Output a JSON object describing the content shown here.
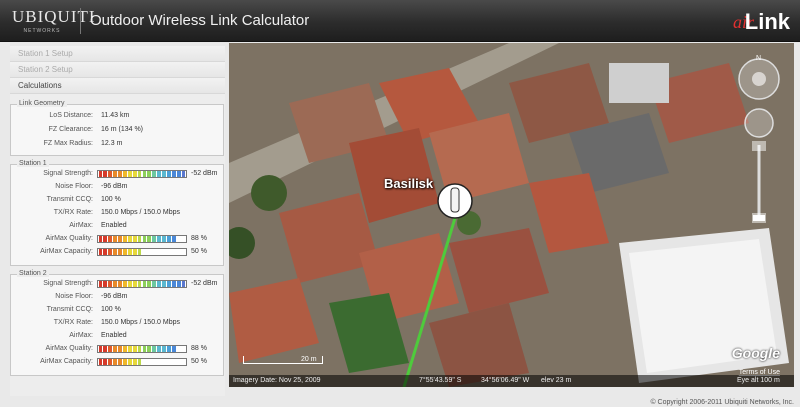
{
  "header": {
    "logo_text": "UBIQUITI",
    "logo_sub": "NETWORKS",
    "title": "Outdoor Wireless Link Calculator",
    "brand_air": "air",
    "brand_link": "Link"
  },
  "nav": [
    {
      "label": "Station 1 Setup",
      "active": false
    },
    {
      "label": "Station 2 Setup",
      "active": false
    },
    {
      "label": "Calculations",
      "active": true
    }
  ],
  "link_geometry": {
    "legend": "Link Geometry",
    "rows": [
      {
        "label": "LoS Distance:",
        "value": "11.43 km"
      },
      {
        "label": "FZ Clearance:",
        "value": "16 m (134 %)"
      },
      {
        "label": "FZ Max Radius:",
        "value": "12.3 m"
      }
    ]
  },
  "station1": {
    "legend": "Station 1",
    "signal_label": "Signal Strength:",
    "signal_value": "-52 dBm",
    "signal_fraction": 1.0,
    "noise_label": "Noise Floor:",
    "noise_value": "-96 dBm",
    "ccq_label": "Transmit CCQ:",
    "ccq_value": "100 %",
    "rate_label": "TX/RX Rate:",
    "rate_value": "150.0 Mbps / 150.0 Mbps",
    "airmax_label": "AirMax:",
    "airmax_value": "Enabled",
    "quality_label": "AirMax Quality:",
    "quality_value": "88 %",
    "quality_fraction": 0.88,
    "capacity_label": "AirMax Capacity:",
    "capacity_value": "50 %",
    "capacity_fraction": 0.5
  },
  "station2": {
    "legend": "Station 2",
    "signal_label": "Signal Strength:",
    "signal_value": "-52 dBm",
    "signal_fraction": 1.0,
    "noise_label": "Noise Floor:",
    "noise_value": "-96 dBm",
    "ccq_label": "Transmit CCQ:",
    "ccq_value": "100 %",
    "rate_label": "TX/RX Rate:",
    "rate_value": "150.0 Mbps / 150.0 Mbps",
    "airmax_label": "AirMax:",
    "airmax_value": "Enabled",
    "quality_label": "AirMax Quality:",
    "quality_value": "88 %",
    "quality_fraction": 0.88,
    "capacity_label": "AirMax Capacity:",
    "capacity_value": "50 %",
    "capacity_fraction": 0.5
  },
  "map": {
    "placemark_label": "Basilisk",
    "imagery_date": "Imagery Date: Nov 25, 2009",
    "lat": "7°55'43.59\" S",
    "lon": "34°56'06.49\" W",
    "elev": "elev 23 m",
    "eye_alt": "Eye alt 100 m",
    "scale_label": "20 m",
    "google": "Google",
    "terms": "Terms of Use",
    "compass_n": "N",
    "link_color": "#4ecb3c"
  },
  "footer": "© Copyright 2006-2011 Ubiquiti Networks, Inc."
}
